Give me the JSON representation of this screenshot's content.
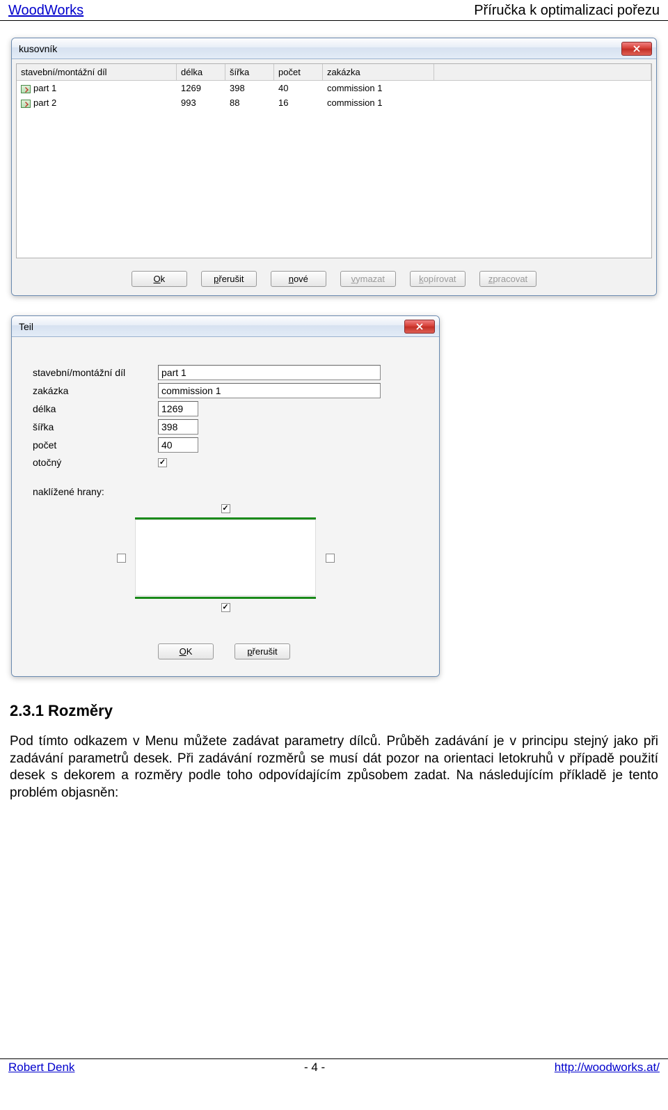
{
  "header": {
    "left": "WoodWorks",
    "right": "Příručka k optimalizaci pořezu"
  },
  "win1": {
    "title": "kusovník",
    "columns": {
      "part": "stavební/montážní díl",
      "len": "délka",
      "wid": "šířka",
      "cnt": "počet",
      "ord": "zakázka"
    },
    "rows": [
      {
        "part": "part 1",
        "len": "1269",
        "wid": "398",
        "cnt": "40",
        "ord": "commission 1"
      },
      {
        "part": "part 2",
        "len": "993",
        "wid": "88",
        "cnt": "16",
        "ord": "commission 1"
      }
    ],
    "buttons": {
      "ok": "Ok",
      "cancel": "přerušit",
      "new": "nové",
      "delete": "vymazat",
      "copy": "kopírovat",
      "process": "zpracovat"
    }
  },
  "win2": {
    "title": "Teil",
    "labels": {
      "part": "stavební/montážní díl",
      "order": "zakázka",
      "len": "délka",
      "wid": "šířka",
      "cnt": "počet",
      "rot": "otočný",
      "edges": "naklížené hrany:"
    },
    "values": {
      "part": "part 1",
      "order": "commission 1",
      "len": "1269",
      "wid": "398",
      "cnt": "40"
    },
    "buttons": {
      "ok": "OK",
      "cancel": "přerušit"
    }
  },
  "section": {
    "heading": "2.3.1   Rozměry",
    "para": "Pod tímto odkazem v Menu můžete zadávat parametry dílců. Průběh zadávání je v principu stejný jako při zadávání  parametrů desek. Při zadávání rozměrů se musí dát pozor na orientaci letokruhů v případě použití desek s dekorem a rozměry podle toho odpovídajícím způsobem zadat. Na následujícím příkladě je tento problém objasněn:"
  },
  "footer": {
    "author": "Robert Denk",
    "page": "- 4 -",
    "url": "http://woodworks.at/"
  }
}
